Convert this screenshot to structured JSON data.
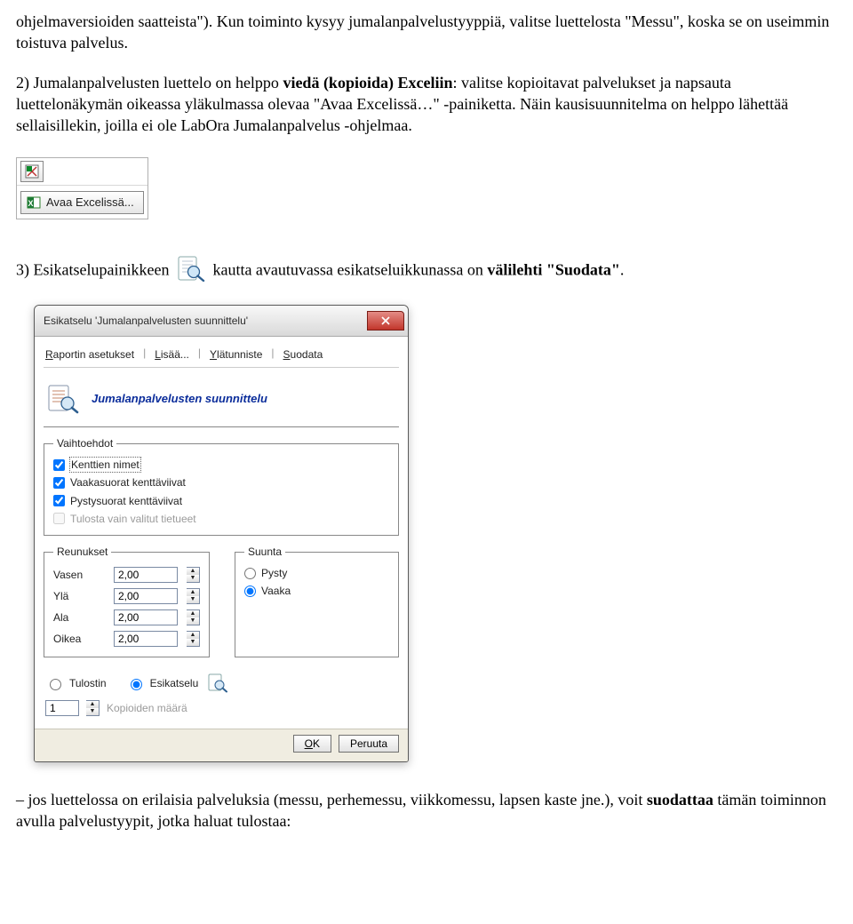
{
  "para1": {
    "pre": "ohjelmaversioiden saatteista\"). Kun toiminto kysyy jumalanpalvelustyyppiä, valitse luettelosta \"Messu\", koska se on useimmin toistuva palvelus."
  },
  "para2": {
    "lead": "2) Jumalanpalvelusten luettelo on helppo ",
    "bold1": "viedä (kopioida) Exceliin",
    "mid": ": valitse kopioitavat palvelukset ja napsauta luettelonäkymän oikeassa yläkulmassa olevaa \"Avaa Excelissä…\" -painiketta. Näin kausisuunnitelma on helppo lähettää sellaisillekin, joilla ei ole LabOra Jumalanpalvelus -ohjelmaa."
  },
  "excelButton": {
    "label": "Avaa Excelissä..."
  },
  "para3": {
    "lead": "3) Esikatselupainikkeen ",
    "mid": " kautta avautuvassa esikatseluikkunassa on ",
    "bold": "välilehti \"Suodata\"",
    "end": "."
  },
  "dialog": {
    "title": "Esikatselu 'Jumalanpalvelusten suunnittelu'",
    "tabs": {
      "t1": "Raportin asetukset",
      "t2": "Lisää...",
      "t3": "Ylätunniste",
      "t4": "Suodata"
    },
    "headerLabel": "Jumalanpalvelusten suunnittelu",
    "options": {
      "legend": "Vaihtoehdot",
      "c1": "Kenttien nimet",
      "c2": "Vaakasuorat kenttäviivat",
      "c3": "Pystysuorat kenttäviivat",
      "c4": "Tulosta vain valitut tietueet"
    },
    "margins": {
      "legend": "Reunukset",
      "rows": {
        "l1": "Vasen",
        "v1": "2,00",
        "l2": "Ylä",
        "v2": "2,00",
        "l3": "Ala",
        "v3": "2,00",
        "l4": "Oikea",
        "v4": "2,00"
      }
    },
    "direction": {
      "legend": "Suunta",
      "r1": "Pysty",
      "r2": "Vaaka"
    },
    "output": {
      "o1": "Tulostin",
      "o2": "Esikatselu"
    },
    "copies": {
      "value": "1",
      "label": "Kopioiden määrä"
    },
    "buttons": {
      "ok": "OK",
      "cancel": "Peruuta"
    }
  },
  "para4": {
    "lead": "– jos luettelossa on erilaisia palveluksia (messu, perhemessu, viikkomessu, lapsen kaste jne.), voit ",
    "bold": "suodattaa",
    "tail": " tämän toiminnon avulla palvelustyypit, jotka haluat tulostaa:"
  }
}
